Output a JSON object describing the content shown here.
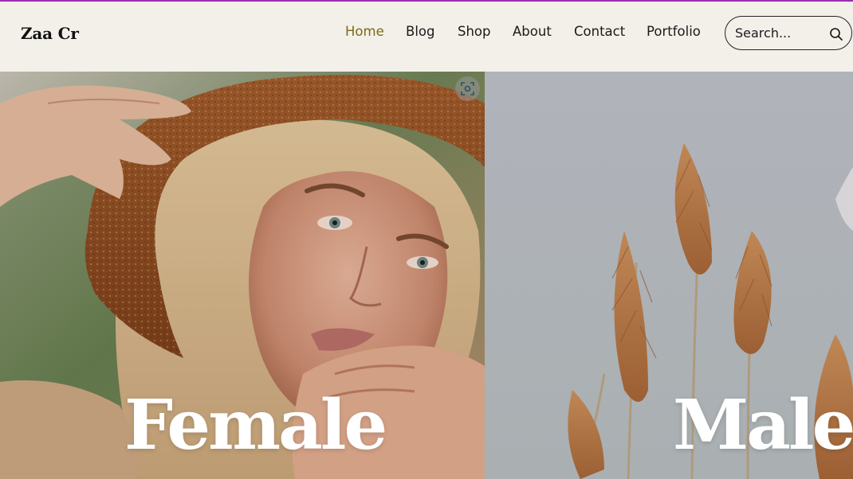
{
  "header": {
    "logo": "Zaa Cr",
    "nav": [
      {
        "label": "Home",
        "active": true
      },
      {
        "label": "Blog",
        "active": false
      },
      {
        "label": "Shop",
        "active": false
      },
      {
        "label": "About",
        "active": false
      },
      {
        "label": "Contact",
        "active": false
      },
      {
        "label": "Portfolio",
        "active": false
      }
    ],
    "search": {
      "placeholder": "Search...",
      "icon": "search-icon"
    }
  },
  "panels": {
    "female": {
      "title": "Female",
      "image": "woman-in-straw-hat-photo"
    },
    "male": {
      "title": "Male",
      "image": "pampas-grass-photo"
    },
    "scan_icon": "image-scan-icon"
  },
  "colors": {
    "background": "#f3f0ea",
    "active_nav": "#7d6a14",
    "accent_line": "#9b2fae",
    "title_text": "#ffffff"
  }
}
